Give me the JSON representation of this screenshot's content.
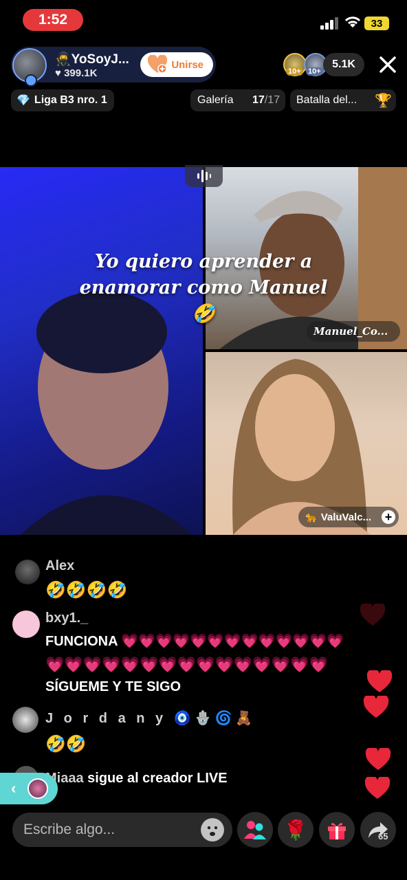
{
  "status_bar": {
    "time": "1:52",
    "battery": "33"
  },
  "host": {
    "name": "YoSoyJ...",
    "likes": "399.1K",
    "join_label": "Unirse",
    "name_icon": "ninja-icon"
  },
  "viewers": {
    "level_1": "10+",
    "level_2": "10+",
    "count": "5.1K"
  },
  "top_pills": {
    "league_label": "Liga B3 nro. 1",
    "gallery_label": "Galería",
    "gallery_count": "17",
    "gallery_total": "/17",
    "battle_label": "Batalla del..."
  },
  "video": {
    "caption_line1": "Yo quiero aprender a",
    "caption_line2": "enamorar como Manuel 🤣",
    "guest1_name": "Manuel_Co...",
    "guest2_name": "ValuValc..."
  },
  "chat": [
    {
      "user": "Alex",
      "text": "🤣🤣🤣🤣"
    },
    {
      "user": "bxy1._",
      "lines": [
        "FUNCIONA 💗💗💗💗💗💗💗💗💗💗💗💗💗",
        "💗💗💗💗💗💗💗💗💗💗💗💗💗💗💗",
        "SÍGUEME Y TE SIGO"
      ]
    },
    {
      "user": "J o r d a n y 🧿🪬🌀🧸",
      "text": "🤣🤣"
    },
    {
      "user": "Miaaa",
      "text": "sigue al creador LIVE"
    }
  ],
  "composer": {
    "placeholder": "Escribe algo..."
  },
  "share": {
    "count": "65"
  },
  "colors": {
    "live_red": "#e5383b",
    "join_orange": "#f07a32",
    "heart_red": "#e8273a",
    "side_tab": "#5fd6d3",
    "host_pill": "#17203f"
  }
}
